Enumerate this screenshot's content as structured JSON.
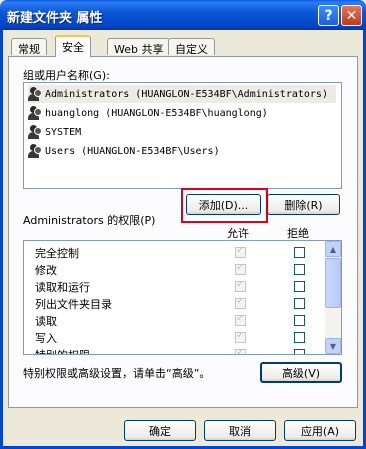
{
  "window": {
    "title": "新建文件夹 属性",
    "help_glyph": "?",
    "close_glyph": "✕"
  },
  "tabs": [
    {
      "label": "常规"
    },
    {
      "label": "安全",
      "active": true
    },
    {
      "label": "Web 共享"
    },
    {
      "label": "自定义"
    }
  ],
  "security": {
    "group_label": "组或用户名称(G):",
    "users": [
      {
        "name": "Administrators (HUANGLON-E534BF\\Administrators)",
        "selected": true
      },
      {
        "name": "huanglong (HUANGLON-E534BF\\huanglong)"
      },
      {
        "name": "SYSTEM"
      },
      {
        "name": "Users (HUANGLON-E534BF\\Users)"
      }
    ],
    "add_button": "添加(D)...",
    "remove_button": "删除(R)",
    "perm_label": "Administrators 的权限(P)",
    "allow_header": "允许",
    "deny_header": "拒绝",
    "permissions": [
      {
        "name": "完全控制"
      },
      {
        "name": "修改"
      },
      {
        "name": "读取和运行"
      },
      {
        "name": "列出文件夹目录"
      },
      {
        "name": "读取"
      },
      {
        "name": "写入"
      },
      {
        "name": "特别的权限"
      }
    ],
    "advanced_text": "特别权限或高级设置，请单击“高级”。",
    "advanced_button": "高级(V)"
  },
  "footer": {
    "ok": "确定",
    "cancel": "取消",
    "apply": "应用(A)"
  },
  "icons": {
    "user": "user-group-icon",
    "up_arrow": "▲",
    "down_arrow": "▼"
  }
}
